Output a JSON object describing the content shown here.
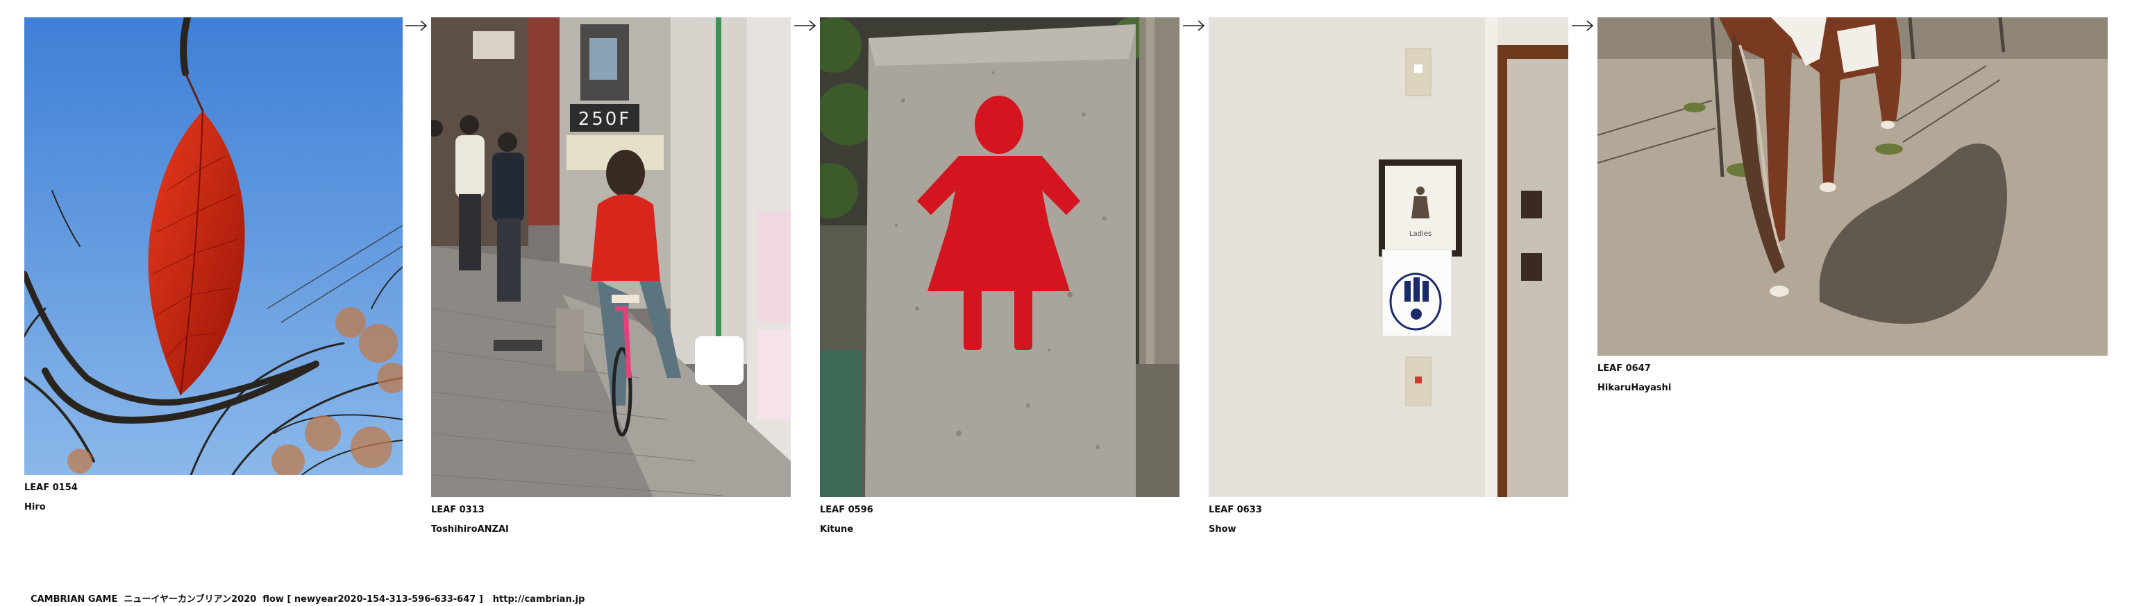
{
  "leaves": [
    {
      "id": "LEAF 0154",
      "author": "Hiro"
    },
    {
      "id": "LEAF 0313",
      "author": "ToshihiroANZAI"
    },
    {
      "id": "LEAF 0596",
      "author": "Kitune"
    },
    {
      "id": "LEAF 0633",
      "author": "Show"
    },
    {
      "id": "LEAF 0647",
      "author": "HikaruHayashi"
    }
  ],
  "photo_text": {
    "shop_sign": "250F",
    "door_sign": "Ladies"
  },
  "footer": {
    "text": "CAMBRIAN GAME  ニューイヤーカンブリアン2020  flow [ newyear2020-154-313-596-633-647 ]",
    "url": "http://cambrian.jp"
  },
  "icons": {
    "arrow": "right-arrow-icon"
  }
}
